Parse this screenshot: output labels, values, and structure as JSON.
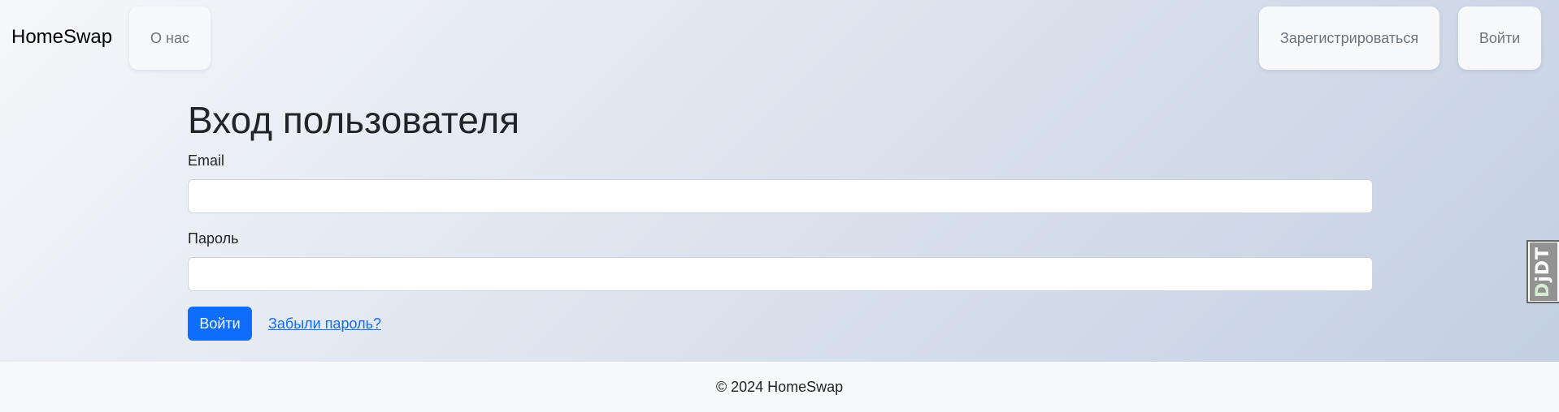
{
  "navbar": {
    "brand": "HomeSwap",
    "about_label": "О нас",
    "register_label": "Зарегистрироваться",
    "login_label": "Войти"
  },
  "login_form": {
    "heading": "Вход пользователя",
    "email_label": "Email",
    "email_value": "",
    "password_label": "Пароль",
    "password_value": "",
    "submit_label": "Войти",
    "forgot_password_label": "Забыли пароль?"
  },
  "footer": {
    "text": "© 2024 HomeSwap"
  },
  "debug_toolbar": {
    "handle_label_first": "D",
    "handle_label_rest": "jDT",
    "icon": "django-debug-toolbar-handle"
  },
  "colors": {
    "primary": "#0d6efd",
    "gradient_start": "#f5f7fa",
    "gradient_end": "#c3cfe2",
    "nav_button_bg": "#f8f9fa",
    "footer_bg": "#f8f9fa"
  }
}
